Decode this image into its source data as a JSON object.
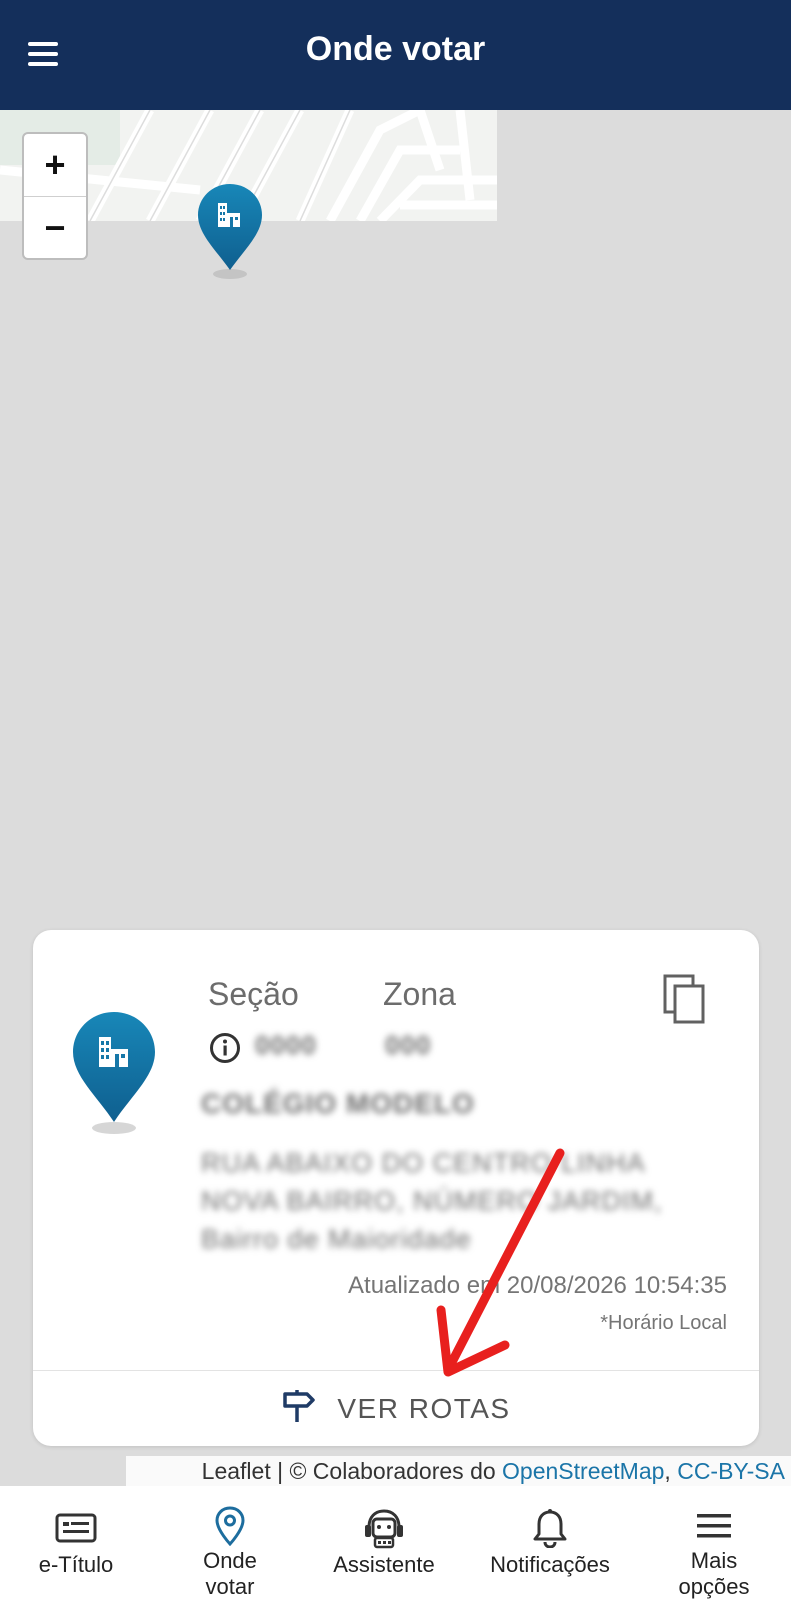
{
  "header": {
    "title": "Onde votar"
  },
  "map": {
    "zoom_in": "+",
    "zoom_out": "−"
  },
  "card": {
    "secao_label": "Seção",
    "zona_label": "Zona",
    "secao_value": "0000",
    "zona_value": "000",
    "place_name": "COLÉGIO MODELO",
    "address": "RUA ABAIXO DO CENTRO LINHA NOVA BAIRRO, NÚMERO JARDIM, Bairro de Maioridade",
    "updated": "Atualizado em 20/08/2026 10:54:35",
    "local_time": "*Horário Local",
    "routes_button": "VER ROTAS"
  },
  "attribution": {
    "prefix": "Leaflet | © Colaboradores do ",
    "osm": "OpenStreetMap",
    "separator": ", ",
    "license": "CC-BY-SA"
  },
  "nav": {
    "items": [
      {
        "label": "e-Título"
      },
      {
        "label": "Onde votar"
      },
      {
        "label": "Assistente"
      },
      {
        "label": "Notificações"
      },
      {
        "label": "Mais opções"
      }
    ]
  },
  "colors": {
    "header": "#142f5b",
    "pin": "#1677a8",
    "arrow": "#e8201e",
    "link": "#1b75a8"
  }
}
